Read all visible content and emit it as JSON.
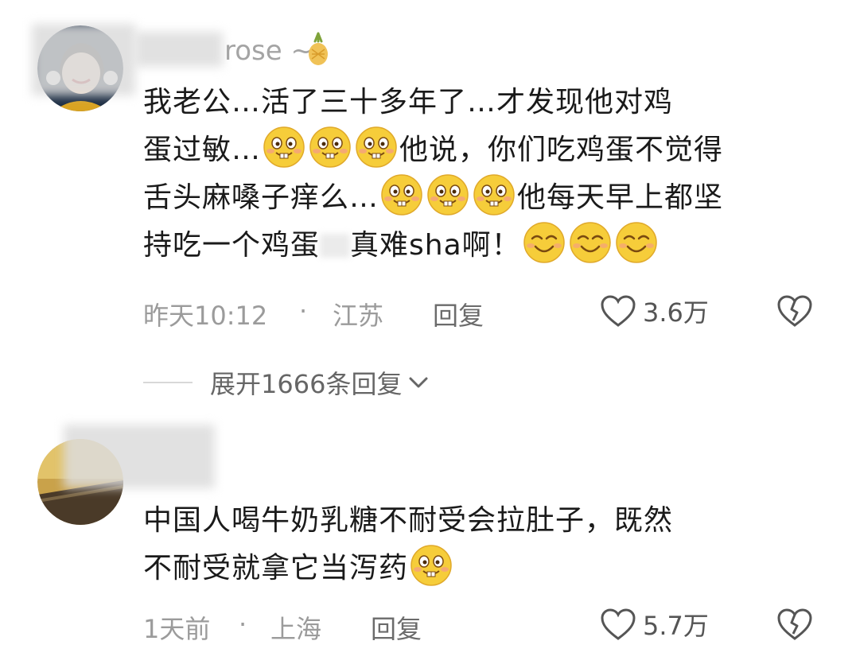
{
  "comments": [
    {
      "username": "rose ~",
      "text_lines": [
        [
          {
            "t": "我老公…活了三十多年了…才发现他对鸡"
          }
        ],
        [
          {
            "t": "蛋过敏…"
          },
          {
            "e": "grin-emoji"
          },
          {
            "e": "grin-emoji"
          },
          {
            "e": "grin-emoji"
          },
          {
            "t": "他说，你们吃鸡蛋不觉得"
          }
        ],
        [
          {
            "t": "舌头麻嗓子痒么…"
          },
          {
            "e": "grin-emoji"
          },
          {
            "e": "grin-emoji"
          },
          {
            "e": "grin-emoji"
          },
          {
            "t": "他每天早上都坚"
          }
        ],
        [
          {
            "t": "持吃一个鸡蛋"
          },
          {
            "s": "smudge"
          },
          {
            "t": "真难sha啊！"
          },
          {
            "e": "smile-emoji"
          },
          {
            "e": "smile-emoji"
          },
          {
            "e": "smile-emoji"
          }
        ]
      ],
      "time": "昨天10:12",
      "separator": "·",
      "location": "江苏",
      "reply_label": "回复",
      "like_count": "3.6万",
      "expand_label": "展开1666条回复"
    },
    {
      "username": "",
      "text_lines": [
        [
          {
            "t": "中国人喝牛奶乳糖不耐受会拉肚子，既然"
          }
        ],
        [
          {
            "t": "不耐受就拿它当泻药"
          },
          {
            "e": "grin-emoji"
          }
        ]
      ],
      "time": "1天前",
      "separator": "·",
      "location": "上海",
      "reply_label": "回复",
      "like_count": "5.7万"
    }
  ],
  "icons": {
    "like": "heart-outline-icon",
    "dislike": "broken-heart-icon",
    "expand": "chevron-down-icon",
    "user_badge": "pineapple-icon"
  },
  "colors": {
    "text": "#1a1a1a",
    "meta": "#9b9b9b",
    "emoji_face": "#f6cd3a"
  }
}
